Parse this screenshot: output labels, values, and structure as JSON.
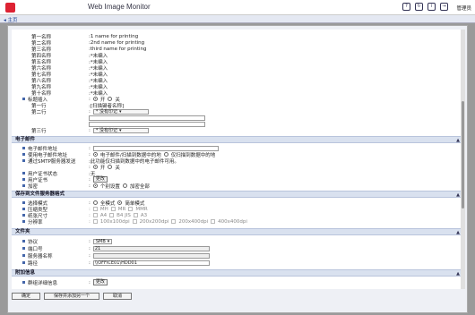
{
  "header": {
    "app_title": "Web Image Monitor",
    "user_label": "管理员",
    "home_link": "主页",
    "icons": [
      "question-icon",
      "refresh-icon",
      "info-icon",
      "logout-icon"
    ]
  },
  "names": [
    {
      "label": "第一名称",
      "value": ":1 name for printing"
    },
    {
      "label": "第二名称",
      "value": ":2nd name for printing"
    },
    {
      "label": "第三名称",
      "value": ":third name for printing"
    },
    {
      "label": "第四名称",
      "value": ":*未编入"
    },
    {
      "label": "第五名称",
      "value": ":*未编入"
    },
    {
      "label": "第六名称",
      "value": ":*未编入"
    },
    {
      "label": "第七名称",
      "value": ":*未编入"
    },
    {
      "label": "第八名称",
      "value": ":*未编入"
    },
    {
      "label": "第九名称",
      "value": ":*未编入"
    },
    {
      "label": "第十名称",
      "value": ":*未编入"
    }
  ],
  "title_insert": {
    "label": "标题插入",
    "off": "开",
    "on": "关",
    "row1_label": "第一行",
    "row1_value": ":[扫描键者名称]",
    "row2_label": "第二行",
    "row2_select": "* 没有印记",
    "row3_label": "第三行",
    "row3_select": "* 没有印记"
  },
  "email_section": {
    "title": "电子邮件",
    "address_label": "电子邮件地址",
    "use_label": "使用电子邮件地址",
    "use_opt1": "电子邮件/扫描到数据中的地",
    "use_opt2": "仅扫描到数据中的地",
    "smtp_label": "通过SMTP服务器发送",
    "smtp_note": ":此功能仅扫描到数据中的电子邮件可用。",
    "smtp_on": "开",
    "smtp_off": "关",
    "cert_status_label": "用户证书状态",
    "cert_status_value": ":无",
    "cert_label": "用户证书",
    "cert_button": "更改",
    "encrypt_label": "加密",
    "encrypt_opt1": "个别设置",
    "encrypt_opt2": "加密全部"
  },
  "scan_section": {
    "title": "保存到文件服务器格式",
    "mode_label": "选择模式",
    "mode_opt1": "全模式",
    "mode_opt2": "简单模式",
    "compress_label": "压缩类型",
    "compress_opts": [
      "MH",
      "MR",
      "MMR"
    ],
    "size_label": "纸张尺寸",
    "size_opts": [
      "A4",
      "B4 JIS",
      "A3"
    ],
    "res_label": "分辨率",
    "res_opts": [
      "100x100dpi",
      "200x200dpi",
      "200x400dpi",
      "400x400dpi"
    ]
  },
  "folder_section": {
    "title": "文件夹",
    "protocol_label": "协议",
    "protocol_value": "SMB",
    "port_label": "端口号",
    "port_value": "21",
    "server_label": "服务器名称",
    "server_value": "",
    "path_label": "路径",
    "path_value": "\\\\OFFICE01\\HDD01"
  },
  "extra_section": {
    "title": "附加信息",
    "label": "群组详细信息",
    "button": "更改"
  },
  "footer": {
    "ok": "确定",
    "save_add": "保存并添加另一个",
    "cancel": "取消"
  }
}
